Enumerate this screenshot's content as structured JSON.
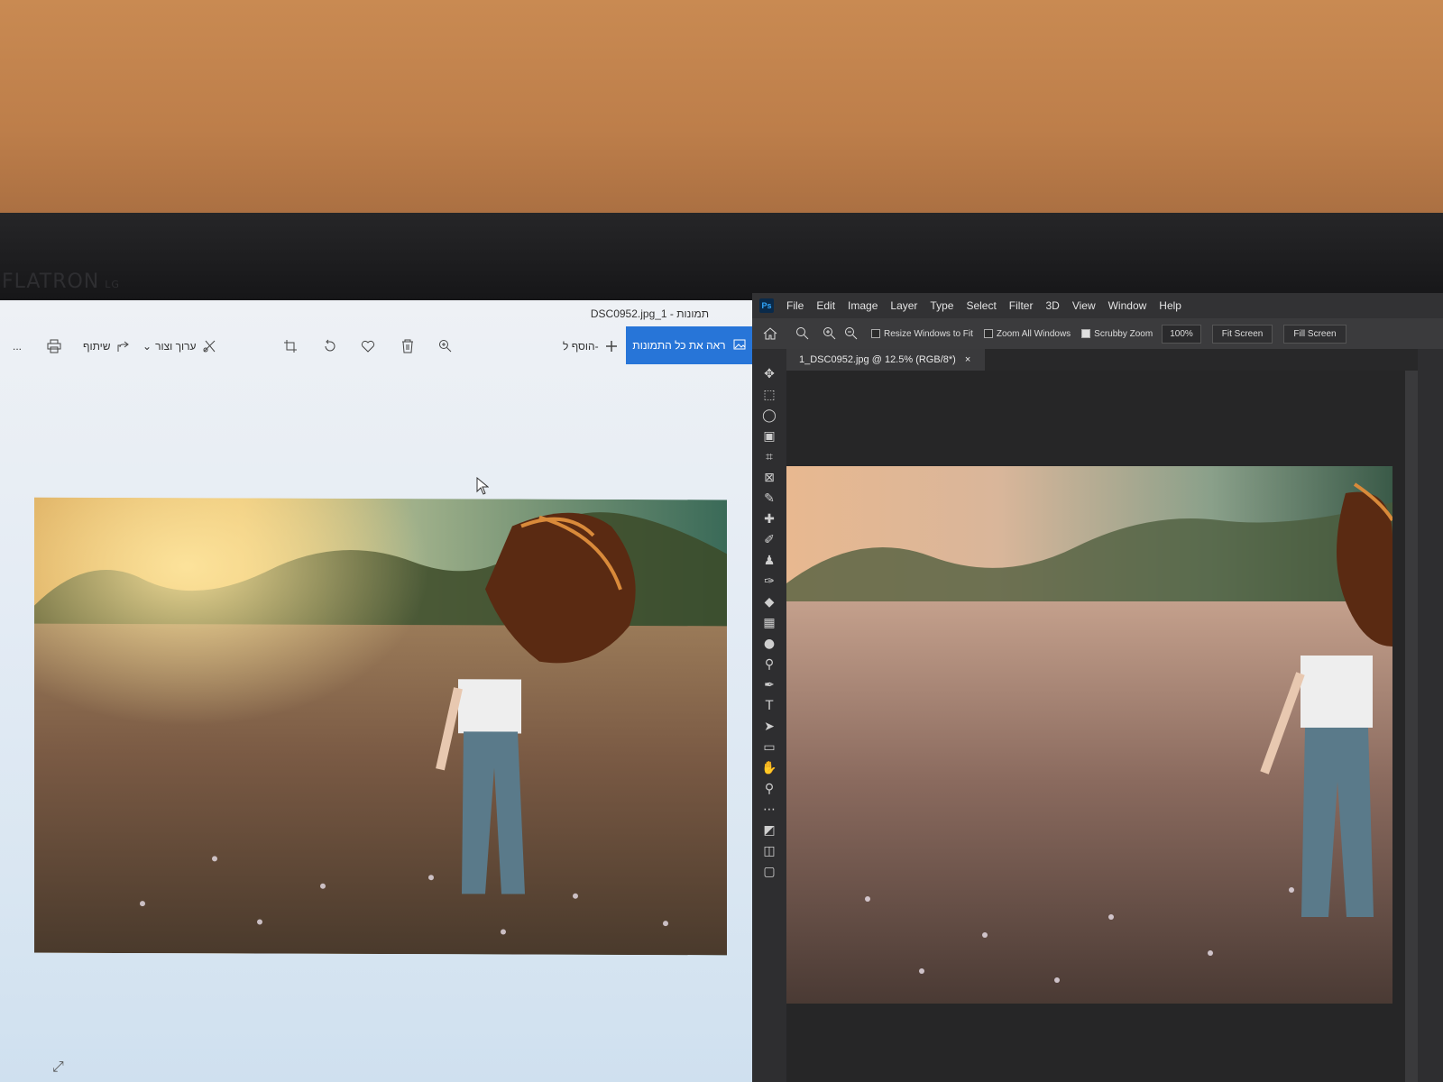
{
  "monitor": {
    "brand": "FLATRON",
    "brand_sub": "LG"
  },
  "photos_app": {
    "title": "DSC0952.jpg_1 - תמונות",
    "toolbar": {
      "more": "...",
      "share": "שיתוף",
      "edit_create": "ערוך וצור",
      "add_to": "הוסף ל-",
      "view_all": "ראה את כל התמונות"
    }
  },
  "photoshop": {
    "logo": "Ps",
    "menu": [
      "File",
      "Edit",
      "Image",
      "Layer",
      "Type",
      "Select",
      "Filter",
      "3D",
      "View",
      "Window",
      "Help"
    ],
    "options": {
      "resize_windows": "Resize Windows to Fit",
      "zoom_all": "Zoom All Windows",
      "scrubby_zoom": "Scrubby Zoom",
      "zoom_value": "100%",
      "fit_screen": "Fit Screen",
      "fill_screen": "Fill Screen"
    },
    "tab": {
      "title": "1_DSC0952.jpg @ 12.5% (RGB/8*)",
      "close": "×"
    }
  },
  "icons": [
    "print-icon",
    "share-icon",
    "edit-icon",
    "crop-icon",
    "rotate-icon",
    "heart-icon",
    "delete-icon",
    "zoom-icon",
    "plus-icon",
    "image-icon",
    "home-icon",
    "move-icon",
    "marquee-icon",
    "lasso-icon",
    "crop-icon",
    "eyedropper-icon",
    "brush-icon",
    "stamp-icon",
    "eraser-icon",
    "gradient-icon",
    "pen-icon",
    "type-icon",
    "hand-icon",
    "zoom-icon"
  ]
}
